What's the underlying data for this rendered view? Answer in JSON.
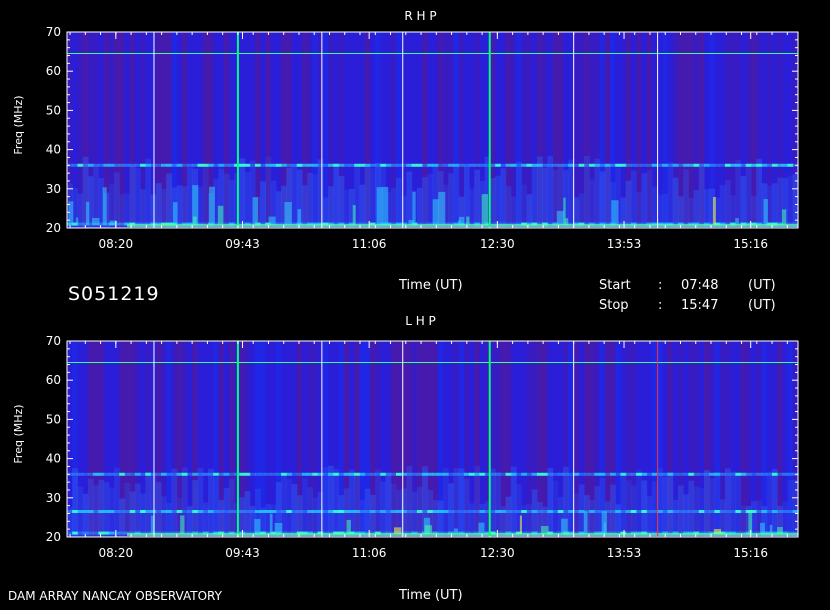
{
  "header": {
    "file_id": "S051219",
    "time_label": "Time (UT)",
    "start_label": "Start",
    "stop_label": "Stop",
    "colon": ":",
    "start_time": "07:48",
    "stop_time": "15:47",
    "ut_unit": "(UT)"
  },
  "footer": {
    "observatory": "DAM ARRAY   NANCAY OBSERVATORY",
    "time_label": "Time (UT)"
  },
  "chart_data": [
    {
      "type": "heatmap",
      "title": "R H P",
      "ylabel": "Freq (MHz)",
      "xlabel": "Time (UT)",
      "x_tick_labels": [
        "08:20",
        "09:43",
        "11:06",
        "12:30",
        "13:53",
        "15:16"
      ],
      "x_tick_minutes": [
        500,
        583,
        666,
        750,
        833,
        916
      ],
      "x_range_minutes": [
        468,
        947
      ],
      "y_ticks": [
        20,
        30,
        40,
        50,
        60,
        70
      ],
      "ylim": [
        20,
        70
      ],
      "emission_bands_mhz": [
        21,
        36
      ],
      "vertical_markers_minutes": [
        {
          "t": 525,
          "color": "#ffffff"
        },
        {
          "t": 580,
          "color": "#00ff80"
        },
        {
          "t": 635,
          "color": "#ffffff"
        },
        {
          "t": 688,
          "color": "#ffffff"
        },
        {
          "t": 745,
          "color": "#00ff80"
        },
        {
          "t": 800,
          "color": "#ffffff"
        },
        {
          "t": 855,
          "color": "#ffffff"
        }
      ],
      "horizontal_marker_mhz": 64.5
    },
    {
      "type": "heatmap",
      "title": "L H P",
      "ylabel": "Freq (MHz)",
      "xlabel": "Time (UT)",
      "x_tick_labels": [
        "08:20",
        "09:43",
        "11:06",
        "12:30",
        "13:53",
        "15:16"
      ],
      "x_tick_minutes": [
        500,
        583,
        666,
        750,
        833,
        916
      ],
      "x_range_minutes": [
        468,
        947
      ],
      "y_ticks": [
        20,
        30,
        40,
        50,
        60,
        70
      ],
      "ylim": [
        20,
        70
      ],
      "emission_bands_mhz": [
        21,
        26.5,
        36
      ],
      "vertical_markers_minutes": [
        {
          "t": 525,
          "color": "#ffffff"
        },
        {
          "t": 580,
          "color": "#00ff80"
        },
        {
          "t": 635,
          "color": "#ffffff"
        },
        {
          "t": 688,
          "color": "#ffffff"
        },
        {
          "t": 745,
          "color": "#00ff80"
        },
        {
          "t": 800,
          "color": "#ffffff"
        },
        {
          "t": 855,
          "color": "#ff3030"
        }
      ],
      "horizontal_marker_mhz": 64.5
    }
  ]
}
